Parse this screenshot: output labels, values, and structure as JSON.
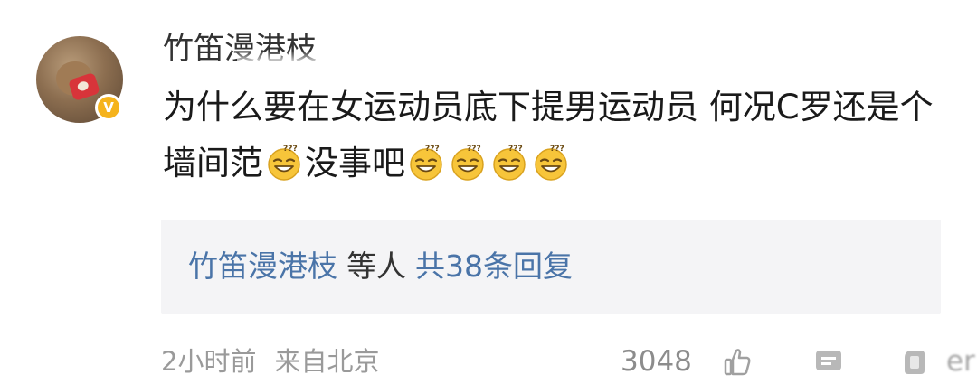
{
  "comment": {
    "username": "竹笛漫港枝",
    "verified_badge": "V",
    "text_part1": "为什么要在女运动员底下提男运动员 何况C罗还是个墙间范",
    "text_part2": "没事吧",
    "emoji_name": "lol-face-emoji",
    "trailing_emoji_count": 4
  },
  "replies": {
    "user": "竹笛漫港枝",
    "middle": "等人",
    "count_text": "共38条回复"
  },
  "meta": {
    "time": "2小时前",
    "location": "来自北京"
  },
  "actions": {
    "like_count": "3048",
    "suffix": "er",
    "icons": [
      "like-icon",
      "comment-icon",
      "share-icon"
    ]
  },
  "colors": {
    "link_blue": "#4a74a8",
    "reply_bg": "#f4f4f6",
    "meta_gray": "#9a9a9a",
    "badge_orange": "#f5b31c",
    "emoji_yellow": "#f7c53a"
  }
}
